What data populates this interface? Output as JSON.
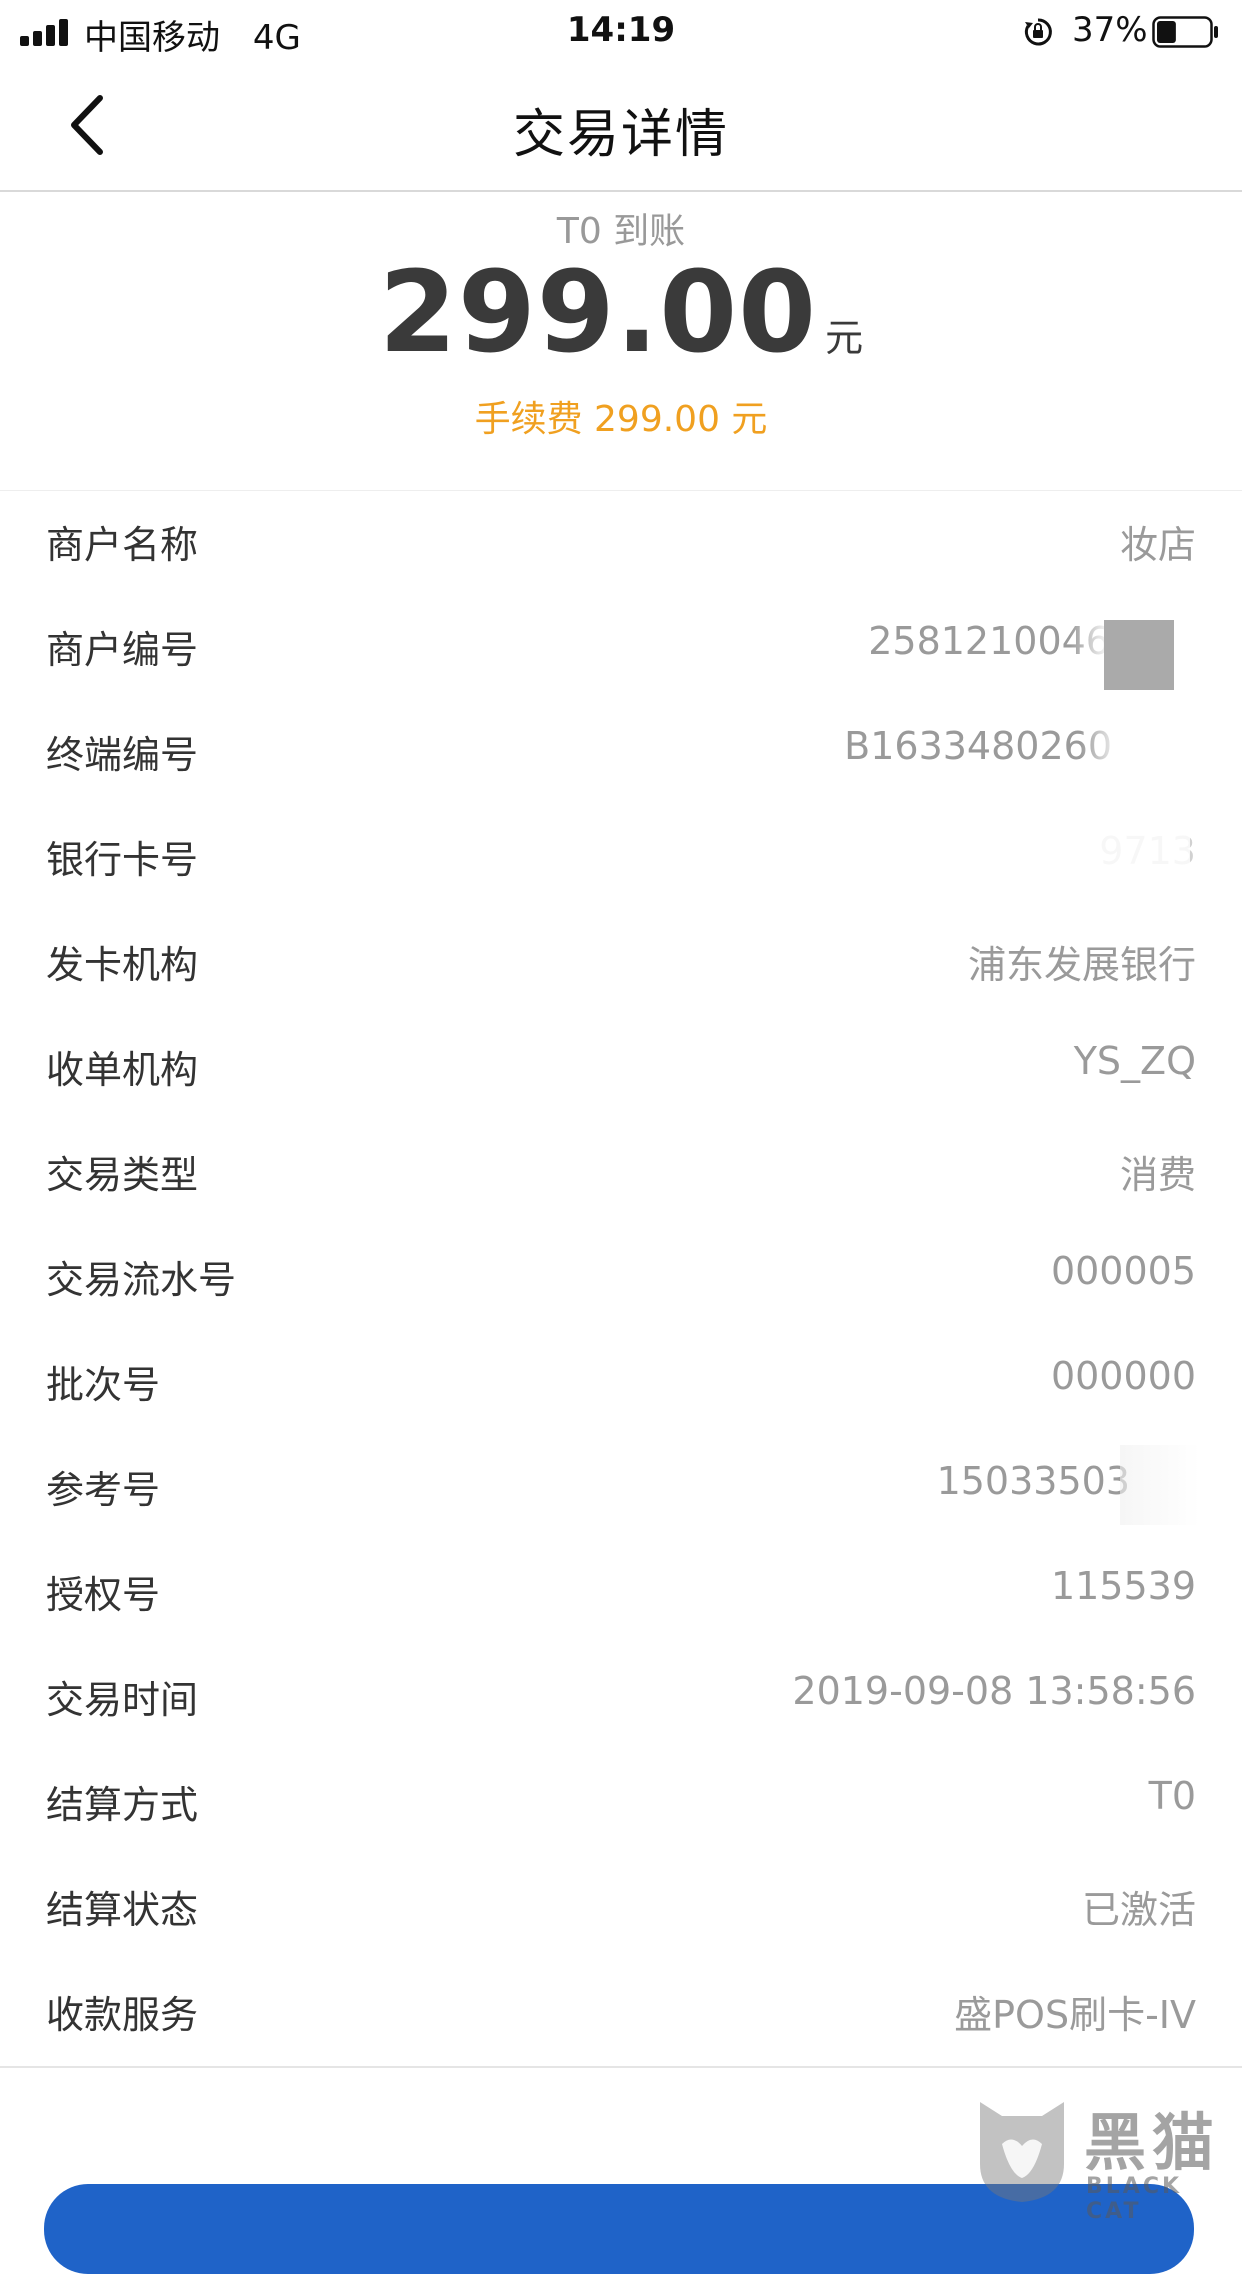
{
  "status_bar": {
    "carrier": "中国移动",
    "network": "4G",
    "time": "14:19",
    "battery_percent": "37%",
    "battery_level": 0.37
  },
  "nav": {
    "title": "交易详情",
    "back_icon": "chevron-left-icon"
  },
  "summary": {
    "settle_label": "T0 到账",
    "amount": "299.00",
    "amount_unit": "元",
    "fee": "手续费 299.00 元",
    "fee_color": "#f0a020"
  },
  "details": [
    {
      "label": "商户名称",
      "value": "妆店"
    },
    {
      "label": "商户编号",
      "value": "2581210046"
    },
    {
      "label": "终端编号",
      "value": "B1633480260"
    },
    {
      "label": "银行卡号",
      "value": "9713"
    },
    {
      "label": "发卡机构",
      "value": "浦东发展银行"
    },
    {
      "label": "收单机构",
      "value": "YS_ZQ"
    },
    {
      "label": "交易类型",
      "value": "消费"
    },
    {
      "label": "交易流水号",
      "value": "000005"
    },
    {
      "label": "批次号",
      "value": "000000"
    },
    {
      "label": "参考号",
      "value": "15033503"
    },
    {
      "label": "授权号",
      "value": "115539"
    },
    {
      "label": "交易时间",
      "value": "2019-09-08 13:58:56"
    },
    {
      "label": "结算方式",
      "value": "T0"
    },
    {
      "label": "结算状态",
      "value": "已激活"
    },
    {
      "label": "收款服务",
      "value": "盛POS刷卡-IV"
    }
  ],
  "watermark": {
    "text_cn": "黑猫",
    "text_en": "BLACK CAT",
    "logo_icon": "black-cat-logo-icon"
  },
  "colors": {
    "accent_blue": "#1f63c8",
    "label_text": "#333333",
    "value_text": "#9a9a9a"
  }
}
